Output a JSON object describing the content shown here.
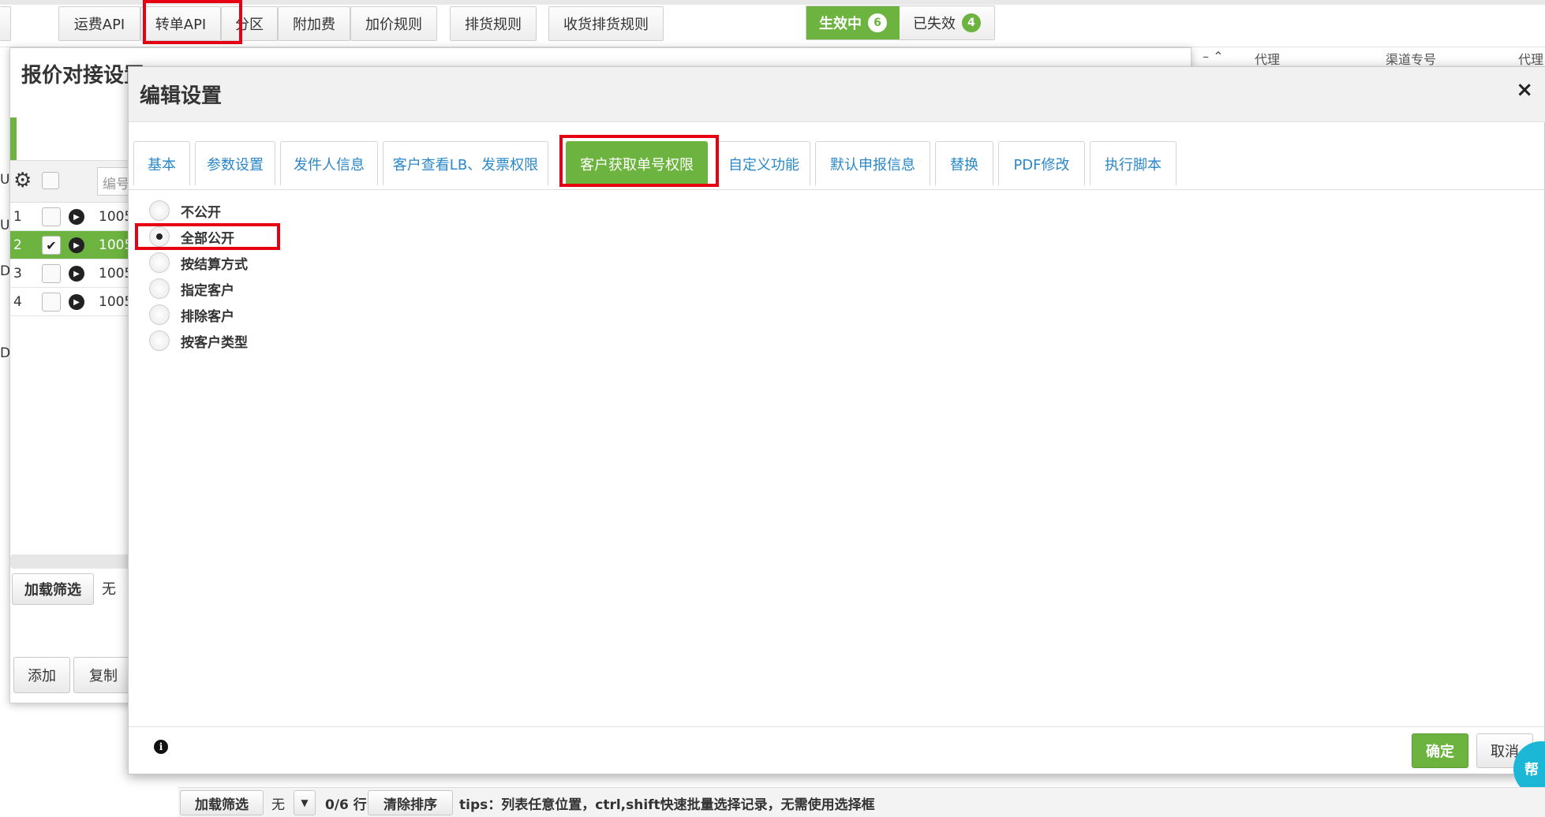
{
  "top_tabs": [
    "运费API",
    "转单API",
    "分区",
    "附加费",
    "加价规则",
    "排货规则",
    "收货排货规则"
  ],
  "status": {
    "active_label": "生效中",
    "active_count": "6",
    "expired_label": "已失效",
    "expired_count": "4"
  },
  "background_window": {
    "title": "报价对接设置",
    "left_fragments": [
      "U",
      "U",
      "DN",
      "DN"
    ],
    "grid_search_placeholder": "编号",
    "rows": [
      {
        "num": "1",
        "code": "1005"
      },
      {
        "num": "2",
        "code": "1005"
      },
      {
        "num": "3",
        "code": "1005"
      },
      {
        "num": "4",
        "code": "1005"
      }
    ],
    "load_filter_label": "加载筛选",
    "filter_value": "无",
    "add_label": "添加",
    "copy_label": "复制",
    "right_header_cols": [
      "代理",
      "渠道专号",
      "代理"
    ]
  },
  "modal": {
    "title": "编辑设置",
    "close_icon": "×",
    "tabs": [
      "基本",
      "参数设置",
      "发件人信息",
      "客户查看LB、发票权限",
      "客户获取单号权限",
      "自定义功能",
      "默认申报信息",
      "替换",
      "PDF修改",
      "执行脚本"
    ],
    "active_tab": "客户获取单号权限",
    "radio_options": [
      "不公开",
      "全部公开",
      "按结算方式",
      "指定客户",
      "排除客户",
      "按客户类型"
    ],
    "selected_option": "全部公开",
    "info_icon": "i",
    "ok_label": "确定",
    "cancel_label": "取消"
  },
  "help_label": "帮",
  "bottom_bar": {
    "load_filter_label": "加载筛选",
    "filter_value": "无",
    "count_text": "0/6 行",
    "clear_sort_label": "清除排序",
    "tips": "tips：列表任意位置，ctrl,shift快速批量选择记录，无需使用选择框"
  },
  "colors": {
    "accent_green": "#6db33f",
    "link_blue": "#2a87c8",
    "highlight_red": "#e60012",
    "help_cyan": "#1cb6d6"
  }
}
